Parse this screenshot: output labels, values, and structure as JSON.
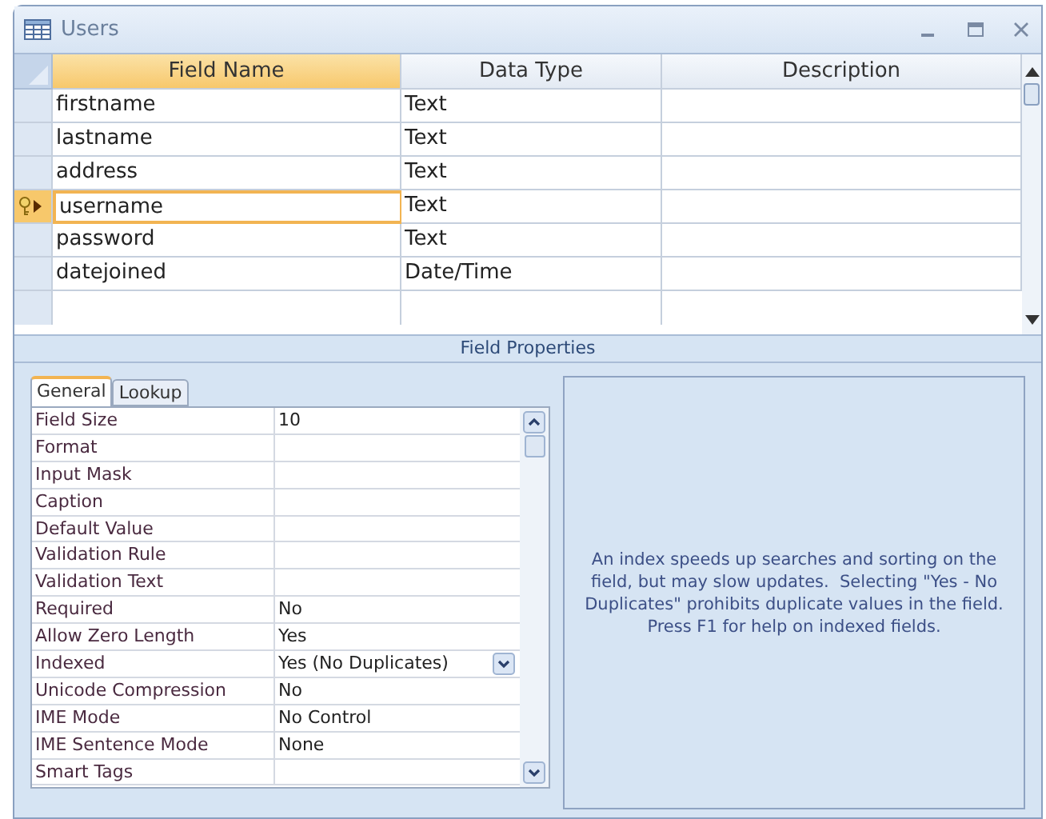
{
  "window": {
    "title": "Users"
  },
  "table": {
    "columns": [
      "Field Name",
      "Data Type",
      "Description"
    ],
    "rows": [
      {
        "field_name": "firstname",
        "data_type": "Text",
        "primary_key": false,
        "selected": false
      },
      {
        "field_name": "lastname",
        "data_type": "Text",
        "primary_key": false,
        "selected": false
      },
      {
        "field_name": "address",
        "data_type": "Text",
        "primary_key": false,
        "selected": false
      },
      {
        "field_name": "username",
        "data_type": "Text",
        "primary_key": true,
        "selected": true
      },
      {
        "field_name": "password",
        "data_type": "Text",
        "primary_key": false,
        "selected": false
      },
      {
        "field_name": "datejoined",
        "data_type": "Date/Time",
        "primary_key": false,
        "selected": false
      }
    ]
  },
  "field_properties": {
    "title": "Field Properties",
    "tabs": [
      {
        "label": "General",
        "selected": true
      },
      {
        "label": "Lookup",
        "selected": false
      }
    ],
    "properties": [
      {
        "label": "Field Size",
        "value": "10",
        "kind": "text"
      },
      {
        "label": "Format",
        "kind": "text"
      },
      {
        "label": "Input Mask",
        "kind": "text"
      },
      {
        "label": "Caption",
        "kind": "text"
      },
      {
        "label": "Default Value",
        "kind": "text"
      },
      {
        "label": "Validation Rule",
        "kind": "text"
      },
      {
        "label": "Validation Text",
        "kind": "text"
      },
      {
        "label": "Required",
        "value": "No",
        "kind": "text"
      },
      {
        "label": "Allow Zero Length",
        "value": "Yes",
        "kind": "text"
      },
      {
        "label": "Indexed",
        "value": "Yes (No Duplicates)",
        "kind": "dropdown"
      },
      {
        "label": "Unicode Compression",
        "value": "No",
        "kind": "text"
      },
      {
        "label": "IME Mode",
        "value": "No Control",
        "kind": "text"
      },
      {
        "label": "IME Sentence Mode",
        "value": "None",
        "kind": "text"
      },
      {
        "label": "Smart Tags",
        "kind": "text"
      }
    ],
    "help": "An index speeds up searches and sorting on the field, but may slow updates.  Selecting \"Yes - No Duplicates\" prohibits duplicate values in the field.  Press F1 for help on indexed fields."
  }
}
